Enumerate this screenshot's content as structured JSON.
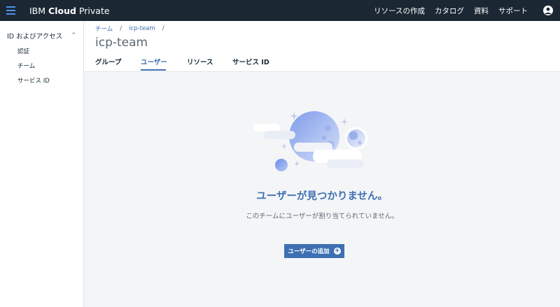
{
  "topbar": {
    "brand_prefix": "IBM",
    "brand_bold": "Cloud",
    "brand_suffix": "Private",
    "nav": [
      "リソースの作成",
      "カタログ",
      "資料",
      "サポート"
    ]
  },
  "sidebar": {
    "section_label": "ID およびアクセス",
    "items": [
      "認証",
      "チーム",
      "サービス ID"
    ]
  },
  "breadcrumb": [
    "チーム",
    "icp-team"
  ],
  "page_title": "icp-team",
  "tabs": [
    "グループ",
    "ユーザー",
    "リソース",
    "サービス ID"
  ],
  "active_tab": "ユーザー",
  "empty_state": {
    "title": "ユーザーが見つかりません。",
    "description": "このチームにユーザーが割り当てられていません。",
    "button_label": "ユーザーの追加"
  },
  "colors": {
    "topbar": "#1b2834",
    "accent": "#3d70b2",
    "main_bg": "#f4f5f7"
  },
  "icons": [
    "hamburger-icon",
    "user-avatar-icon",
    "chevron-up-icon",
    "add-circle-icon",
    "empty-state-illustration"
  ]
}
